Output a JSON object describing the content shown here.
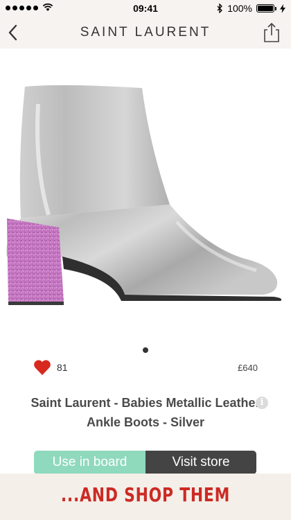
{
  "status_bar": {
    "time": "09:41",
    "battery": "100%",
    "icons": [
      "signal-dots-icon",
      "wifi-icon",
      "bluetooth-icon",
      "battery-icon",
      "charging-icon"
    ]
  },
  "nav": {
    "title": "SAINT LAURENT",
    "back_icon": "chevron-left-icon",
    "share_icon": "share-icon"
  },
  "product": {
    "image": "silver-ankle-boot-with-pink-glitter-heel",
    "likes": "81",
    "price": "£640",
    "title": "Saint Laurent - Babies Metallic Leather Ankle Boots - Silver",
    "carousel_pages": 1,
    "carousel_current": 1
  },
  "actions": {
    "use_in_board": "Use in board",
    "visit_store": "Visit store"
  },
  "promo": {
    "text": "...AND SHOP THEM"
  },
  "colors": {
    "accent_green": "#8fd9bd",
    "dark_button": "#444444",
    "heart_red": "#d8291f",
    "promo_red": "#cc2a24",
    "header_bg": "#f6f3f0"
  }
}
